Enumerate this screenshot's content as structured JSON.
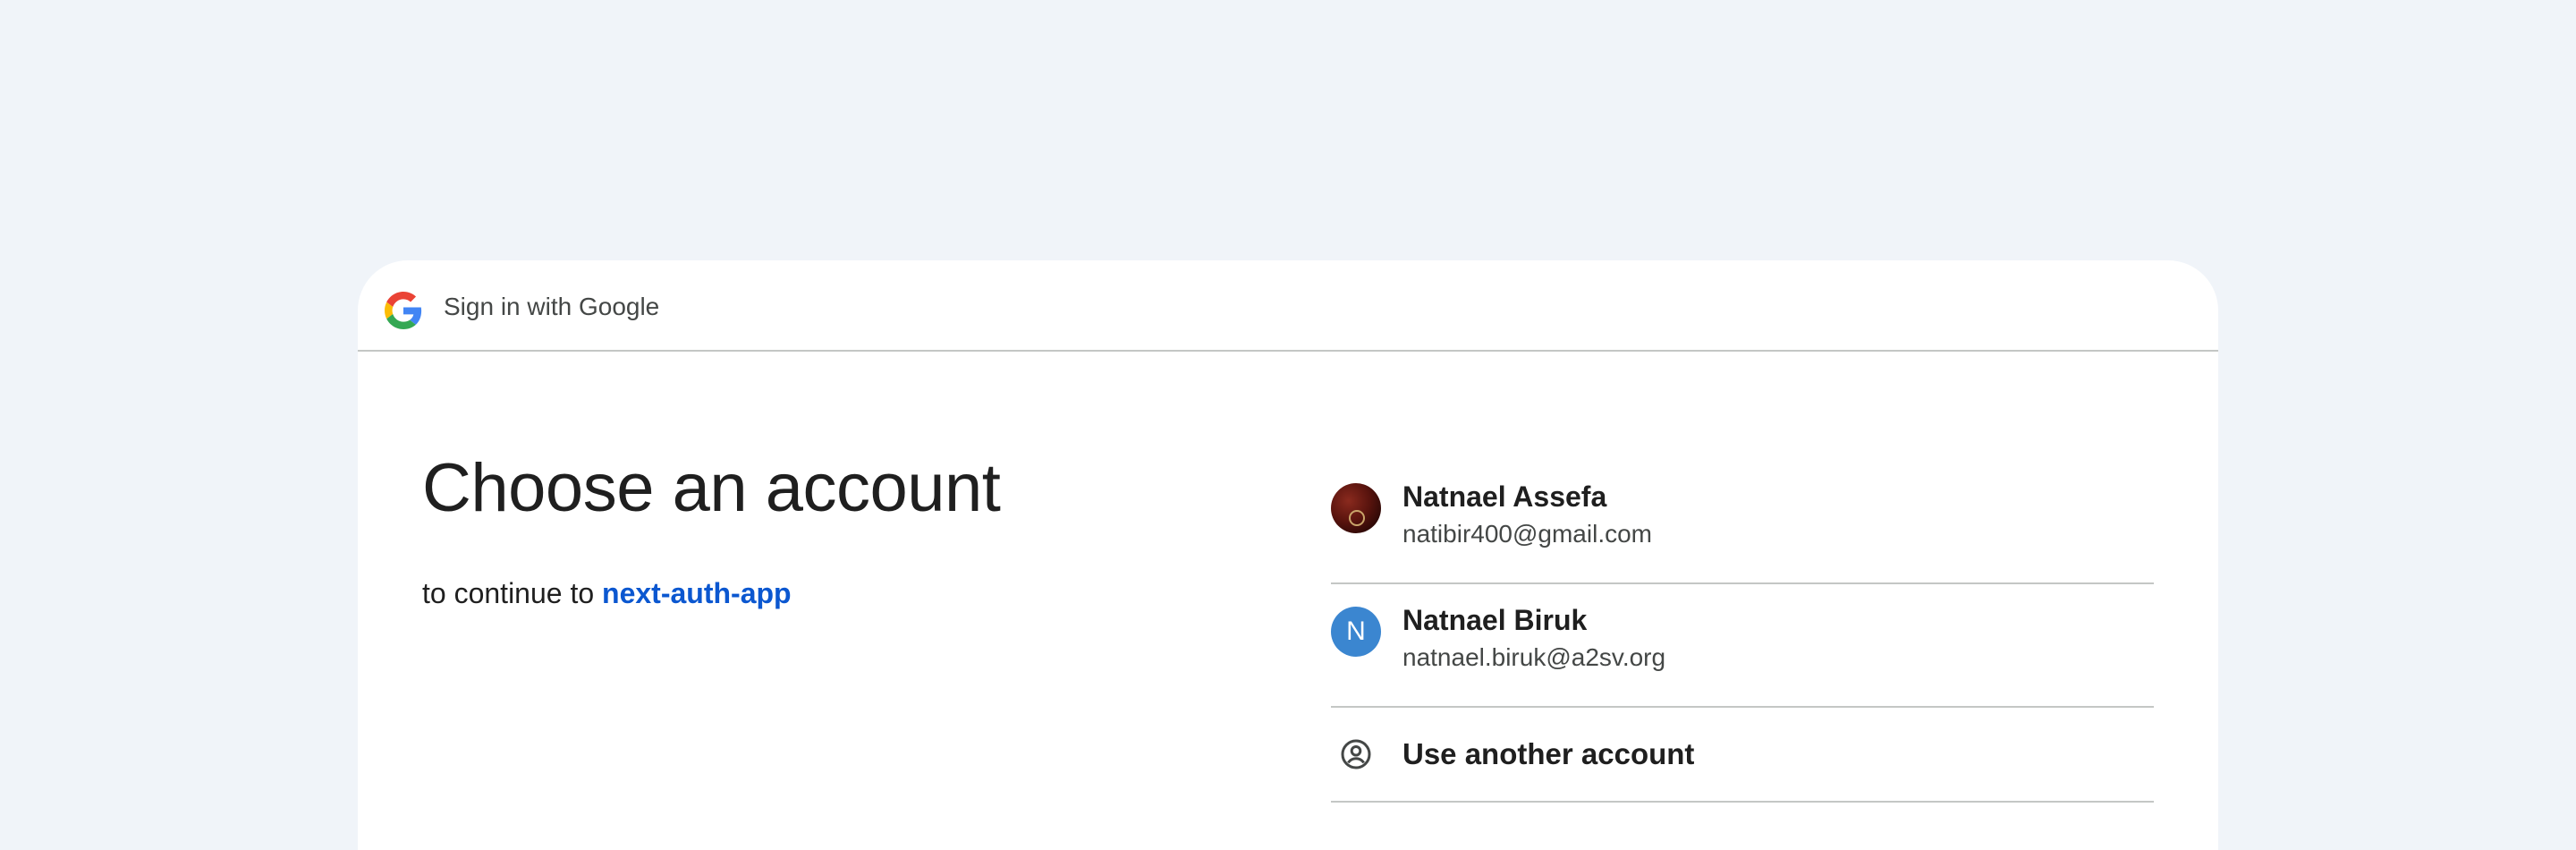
{
  "header": {
    "title": "Sign in with Google",
    "logo_icon": "google-g-icon"
  },
  "main": {
    "heading": "Choose an account",
    "subtitle_prefix": "to continue to ",
    "app_name": "next-auth-app"
  },
  "accounts": [
    {
      "name": "Natnael Assefa",
      "email": "natibir400@gmail.com",
      "avatar": "photo"
    },
    {
      "name": "Natnael Biruk",
      "email": "natnael.biruk@a2sv.org",
      "avatar_letter": "N",
      "avatar_color": "#3b86d0"
    }
  ],
  "another_account": {
    "label": "Use another account",
    "icon": "account-circle-icon"
  },
  "colors": {
    "background": "#f0f4f9",
    "link": "#0b57d0",
    "divider": "#c4c7c5"
  }
}
